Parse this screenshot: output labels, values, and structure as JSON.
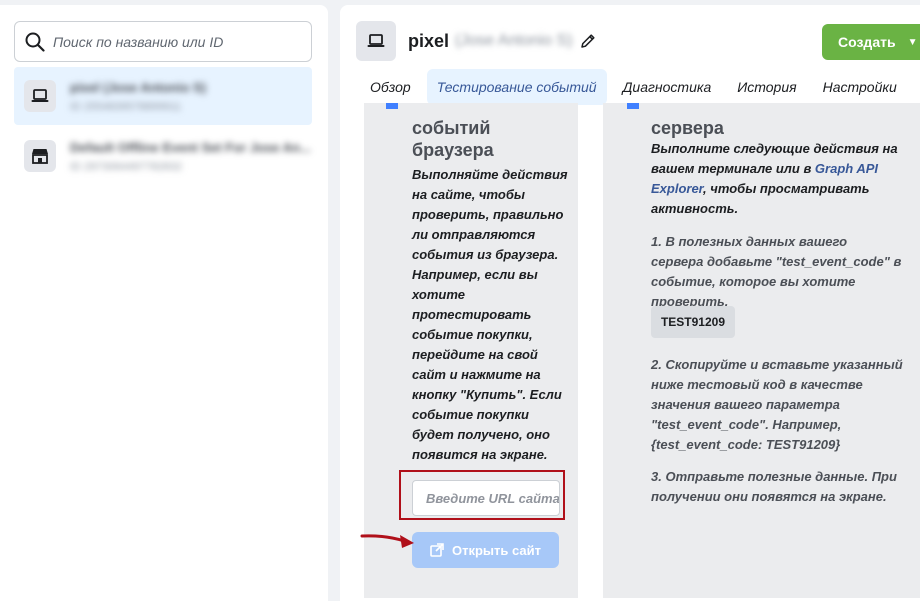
{
  "sidebar": {
    "search_placeholder": "Поиск по названию или ID",
    "items": [
      {
        "title": "pixel (Jose Antonio S)",
        "subtitle": "ID 2554839578899911",
        "icon": "laptop-icon"
      },
      {
        "title": "Default Offline Event Set For Jose An...",
        "subtitle": "ID 2973064497782832",
        "icon": "store-icon"
      }
    ]
  },
  "header": {
    "name": "pixel",
    "name_blurred": "(Jose Antonio S)",
    "create_label": "Создать"
  },
  "tabs": [
    {
      "label": "Обзор"
    },
    {
      "label": "Тестирование событий",
      "active": true
    },
    {
      "label": "Диагностика"
    },
    {
      "label": "История"
    },
    {
      "label": "Настройки"
    }
  ],
  "browser_card": {
    "title": "событий браузера",
    "description": "Выполняйте действия на сайте, чтобы проверить, правильно ли отправляются события из браузера. Например, если вы хотите протестировать событие покупки, перейдите на свой сайт и нажмите на кнопку \"Купить\". Если событие покупки будет получено, оно появится на экране.",
    "url_placeholder": "Введите URL сайта",
    "open_button": "Открыть сайт"
  },
  "server_card": {
    "title": "сервера",
    "desc_prefix": "Выполните следующие действия на вашем терминале или в ",
    "desc_link": "Graph API Explorer",
    "desc_suffix": ", чтобы просматривать активность.",
    "step1": "1. В полезных данных вашего сервера добавьте \"test_event_code\" в событие, которое вы хотите проверить.",
    "test_code": "TEST91209",
    "step2": "2. Скопируйте и вставьте указанный ниже тестовый код в качестве значения вашего параметра \"test_event_code\". Например, {test_event_code: TEST91209}",
    "step3": "3. Отправьте полезные данные. При получении они появятся на экране."
  },
  "colors": {
    "accent_green": "#6ab344",
    "active_tab_bg": "#e7f3ff",
    "highlight_red": "#b0101a"
  }
}
